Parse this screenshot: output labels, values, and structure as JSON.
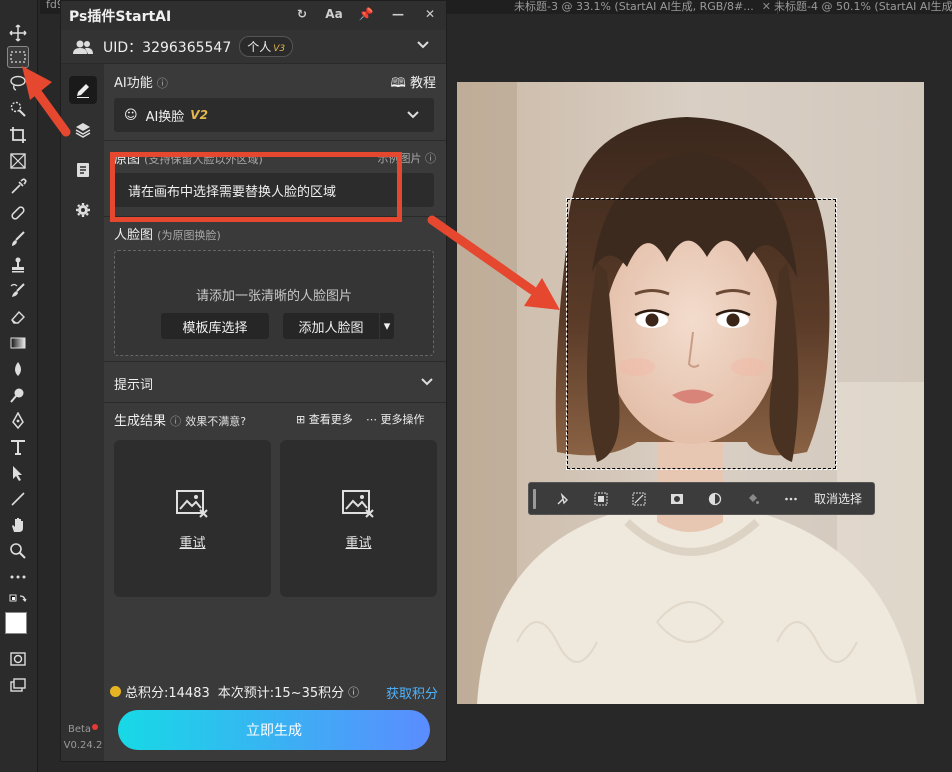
{
  "doc_tabs": [
    {
      "label": "fd9",
      "closable": false
    },
    {
      "label": "未标题-3 @ 33.1% (StartAI AI生成, RGB/8#...",
      "closable": true
    },
    {
      "label": "未标题-4 @ 50.1% (StartAI AI生成, RGB/8#...",
      "closable": true
    }
  ],
  "panel": {
    "title": "Ps插件StartAI",
    "controls": [
      "↻",
      "Aa",
      "📌",
      "—",
      "✕"
    ],
    "uid_label": "UID：3296365547",
    "account_type": "个人",
    "account_level": "V3"
  },
  "ai_function": {
    "label": "AI功能",
    "tutorial": "教程",
    "selected": "AI换脸",
    "selected_version": "V2"
  },
  "original": {
    "label": "原图",
    "note": "(支持保留人脸以外区域)",
    "example": "示例图片",
    "value": "请在画布中选择需要替换人脸的区域"
  },
  "face": {
    "label": "人脸图",
    "note": "(为原图换脸)",
    "hint": "请添加一张清晰的人脸图片",
    "template_button": "模板库选择",
    "add_button": "添加人脸图"
  },
  "prompt": {
    "label": "提示词"
  },
  "results": {
    "label": "生成结果",
    "unsatisfied": "效果不满意?",
    "view_more": "查看更多",
    "more_actions": "更多操作",
    "cards": [
      {
        "retry": "重试"
      },
      {
        "retry": "重试"
      }
    ]
  },
  "footer": {
    "total_credits": "总积分:14483",
    "estimate": "本次预计:15~35积分",
    "get_credits": "获取积分",
    "generate": "立即生成",
    "beta": "Beta",
    "version": "V0.24.2"
  },
  "context_bar": {
    "deselect": "取消选择"
  },
  "colors": {
    "accent_red": "#e5472f",
    "generate_start": "#17d9e6",
    "generate_end": "#5b8cff",
    "link_blue": "#4fb3ff",
    "gold": "#e2b84d"
  }
}
